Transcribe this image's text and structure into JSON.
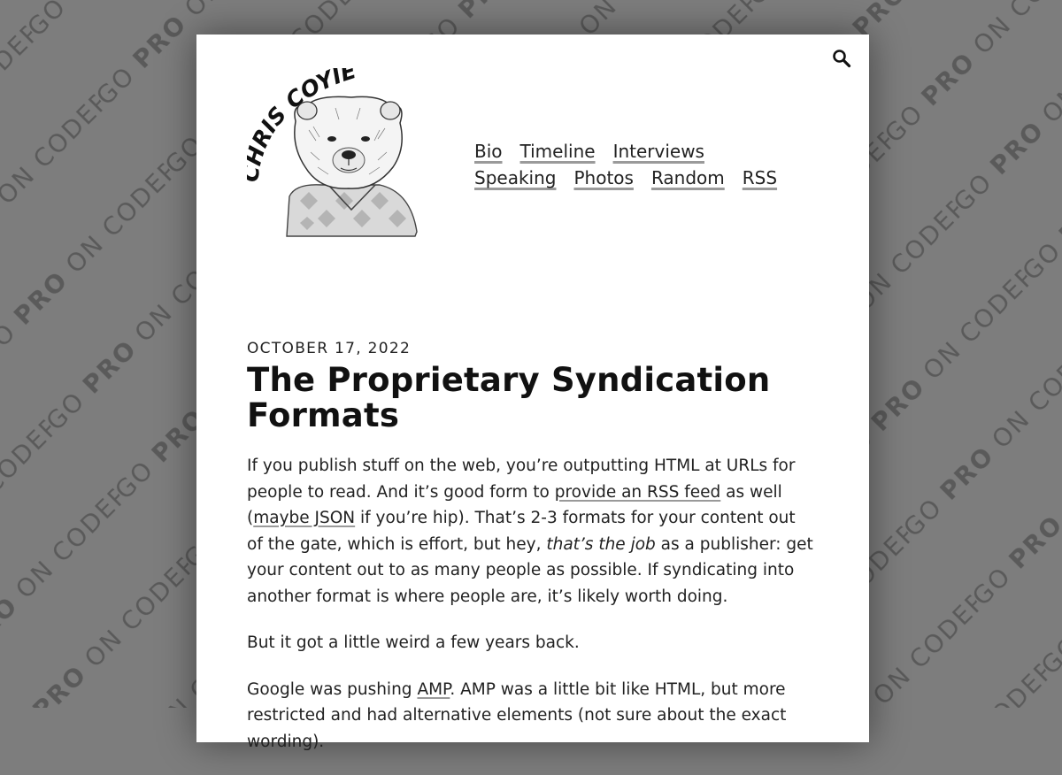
{
  "background": {
    "watermark_text": "GO PRO ON CODEPEN",
    "colors": {
      "bg": "#7d7d7d",
      "text": "#555555"
    }
  },
  "header": {
    "logo_text": "CHRIS COYIER",
    "search_icon": "search-icon"
  },
  "nav": {
    "row1": [
      {
        "label": "Bio"
      },
      {
        "label": "Timeline"
      },
      {
        "label": "Interviews"
      }
    ],
    "row2": [
      {
        "label": "Speaking"
      },
      {
        "label": "Photos"
      },
      {
        "label": "Random"
      },
      {
        "label": "RSS"
      }
    ]
  },
  "post": {
    "date": "OCTOBER 17, 2022",
    "title": "The Proprietary Syndication Formats",
    "p1": {
      "a": "If you publish stuff on the web, you’re outputting HTML at URLs for people to read. And it’s good form to ",
      "link1": "provide an RSS feed",
      "b": " as well (",
      "link2": "maybe JSON",
      "c": " if you’re hip). That’s 2-3 formats for your content out of the gate, which is effort, but hey, ",
      "em": "that’s the job",
      "d": " as a publisher: get your content out to as many people as possible. If syndicating into another format is where people are, it’s likely worth doing."
    },
    "p2": "But it got a little weird a few years back.",
    "p3": {
      "a": "Google was pushing ",
      "link": "AMP",
      "b": ". AMP was a little bit like HTML, but more restricted and had alternative elements (not sure about the exact wording)."
    }
  }
}
